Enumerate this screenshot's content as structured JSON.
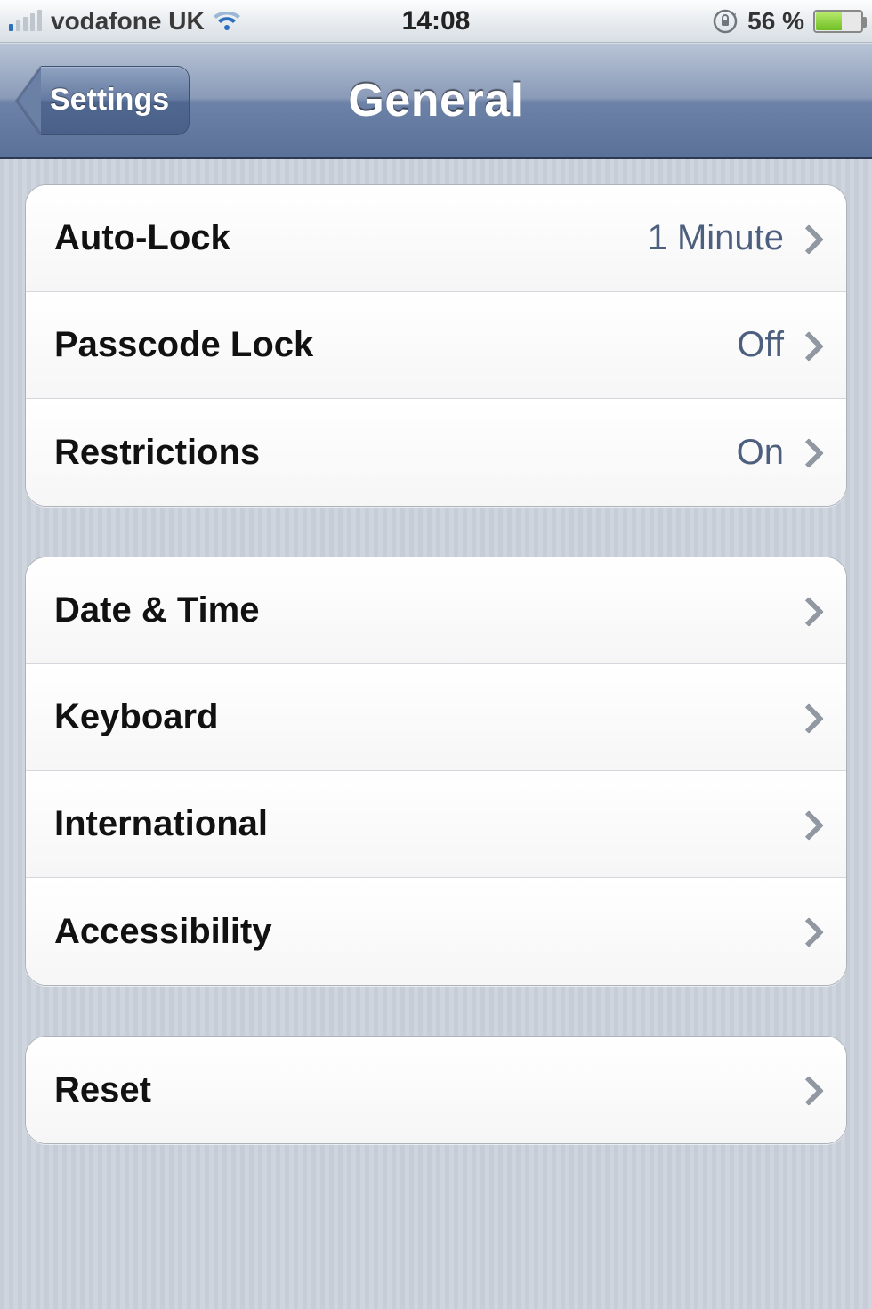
{
  "status": {
    "carrier": "vodafone UK",
    "time": "14:08",
    "battery_pct": "56 %"
  },
  "nav": {
    "back_label": "Settings",
    "title": "General"
  },
  "groups": [
    {
      "rows": [
        {
          "label": "Auto-Lock",
          "value": "1 Minute"
        },
        {
          "label": "Passcode Lock",
          "value": "Off"
        },
        {
          "label": "Restrictions",
          "value": "On"
        }
      ]
    },
    {
      "rows": [
        {
          "label": "Date & Time",
          "value": ""
        },
        {
          "label": "Keyboard",
          "value": ""
        },
        {
          "label": "International",
          "value": ""
        },
        {
          "label": "Accessibility",
          "value": ""
        }
      ]
    },
    {
      "rows": [
        {
          "label": "Reset",
          "value": ""
        }
      ]
    }
  ]
}
